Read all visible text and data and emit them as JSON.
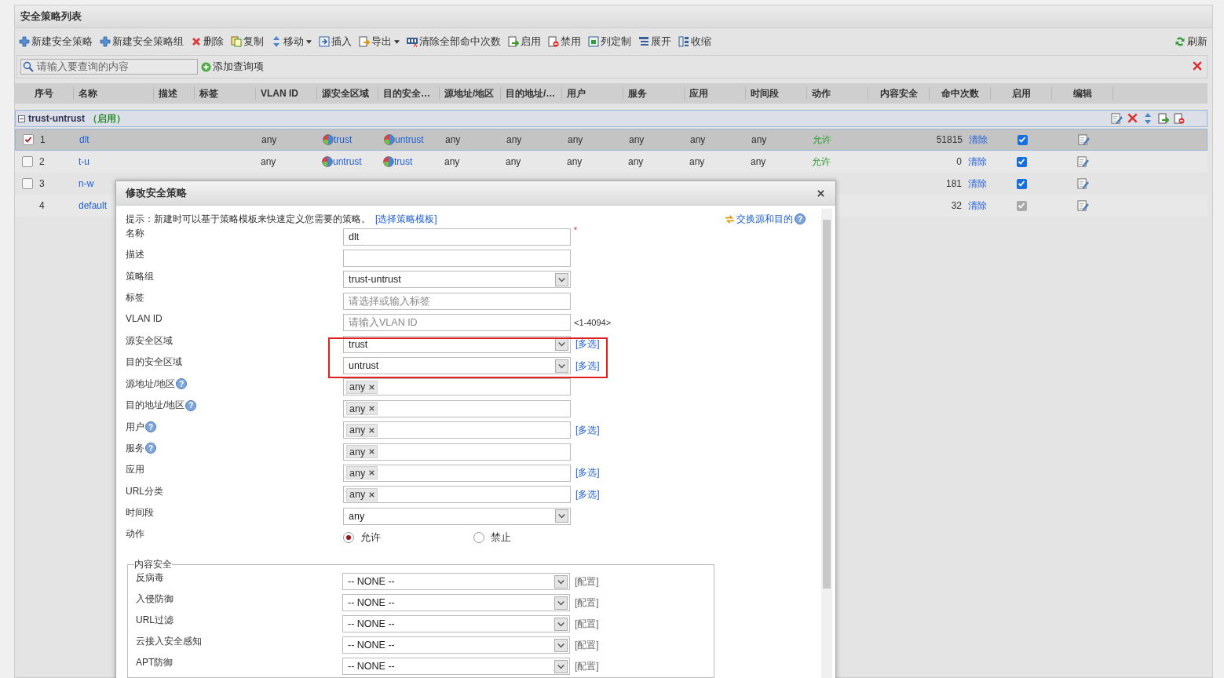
{
  "panel": {
    "title": "安全策略列表"
  },
  "toolbar": [
    {
      "label": "新建安全策略",
      "kind": "plus"
    },
    {
      "label": "新建安全策略组",
      "kind": "plus"
    },
    {
      "label": "删除",
      "kind": "delete"
    },
    {
      "label": "复制",
      "kind": "copy"
    },
    {
      "label": "移动",
      "kind": "move",
      "dropdown": true
    },
    {
      "label": "插入",
      "kind": "insert"
    },
    {
      "label": "导出",
      "kind": "export",
      "dropdown": true
    },
    {
      "label": "清除全部命中次数",
      "kind": "counter"
    },
    {
      "label": "启用",
      "kind": "enable"
    },
    {
      "label": "禁用",
      "kind": "disable"
    },
    {
      "label": "列定制",
      "kind": "columns"
    },
    {
      "label": "展开",
      "kind": "expand"
    },
    {
      "label": "收缩",
      "kind": "collapse"
    }
  ],
  "refresh": "刷新",
  "search": {
    "placeholder": "请输入要查询的内容",
    "add_label": "添加查询项"
  },
  "table": {
    "columns": [
      "序号",
      "名称",
      "描述",
      "标签",
      "VLAN ID",
      "源安全区域",
      "目的安全…",
      "源地址/地区",
      "目的地址/…",
      "用户",
      "服务",
      "应用",
      "时间段",
      "动作",
      "内容安全",
      "命中次数",
      "启用",
      "编辑"
    ],
    "group": {
      "name": "trust-untrust",
      "status": "（启用）",
      "expanded": true
    },
    "rows": [
      {
        "selected": true,
        "checked": true,
        "index": "1",
        "name": "dlt",
        "vlan": "any",
        "src_zone": "trust",
        "dst_zone": "untrust",
        "src_addr": "any",
        "dst_addr": "any",
        "user": "any",
        "service": "any",
        "app": "any",
        "time": "any",
        "action": "允许",
        "hits": "51815",
        "clear": "清除",
        "enabled": true,
        "disabled": false
      },
      {
        "selected": false,
        "checked": false,
        "index": "2",
        "name": "t-u",
        "vlan": "any",
        "src_zone": "untrust",
        "dst_zone": "trust",
        "src_addr": "any",
        "dst_addr": "any",
        "user": "any",
        "service": "any",
        "app": "any",
        "time": "any",
        "action": "允许",
        "hits": "0",
        "clear": "清除",
        "enabled": true,
        "disabled": false
      },
      {
        "selected": false,
        "checked": false,
        "index": "3",
        "name": "n-w",
        "hits": "181",
        "clear": "清除",
        "enabled": true,
        "disabled": false
      },
      {
        "selected": false,
        "index": "4",
        "name": "default",
        "hits": "32",
        "clear": "清除",
        "enabled": true,
        "disabled": true
      }
    ]
  },
  "dialog": {
    "title": "修改安全策略",
    "hint": "提示：新建时可以基于策略模板来快速定义您需要的策略。",
    "template_link": "[选择策略模板]",
    "swap_link": "交换源和目的",
    "swap_help": "?",
    "fields": [
      {
        "label": "名称",
        "kind": "text",
        "value": "dlt",
        "mark": "*"
      },
      {
        "label": "描述",
        "kind": "text"
      },
      {
        "label": "策略组",
        "kind": "select",
        "value": "trust-untrust"
      },
      {
        "label": "标签",
        "kind": "text",
        "placeholder": "请选择或输入标签"
      },
      {
        "label": "VLAN ID",
        "kind": "text",
        "placeholder": "请输入VLAN ID",
        "note": "<1-4094>"
      },
      {
        "label": "源安全区域",
        "kind": "select",
        "value": "trust",
        "link": "[多选]"
      },
      {
        "label": "目的安全区域",
        "kind": "select",
        "value": "untrust",
        "link": "[多选]"
      },
      {
        "label": "源地址/地区",
        "help": "?",
        "kind": "tags",
        "tags": [
          "any"
        ]
      },
      {
        "label": "目的地址/地区",
        "help": "?",
        "kind": "tags",
        "tags": [
          "any"
        ]
      },
      {
        "label": "用户",
        "help": "?",
        "kind": "tags",
        "tags": [
          "any"
        ],
        "link": "[多选]"
      },
      {
        "label": "服务",
        "help": "?",
        "kind": "tags",
        "tags": [
          "any"
        ]
      },
      {
        "label": "应用",
        "kind": "tags",
        "tags": [
          "any"
        ],
        "link": "[多选]"
      },
      {
        "label": "URL分类",
        "kind": "tags",
        "tags": [
          "any"
        ],
        "link": "[多选]"
      },
      {
        "label": "时间段",
        "kind": "select",
        "value": "any"
      },
      {
        "label": "动作",
        "kind": "radio",
        "options": [
          {
            "label": "允许",
            "selected": true
          },
          {
            "label": "禁止",
            "selected": false
          }
        ]
      }
    ],
    "content_security": {
      "legend": "内容安全",
      "items": [
        {
          "label": "反病毒",
          "value": "-- NONE --",
          "link": "[配置]"
        },
        {
          "label": "入侵防御",
          "value": "-- NONE --",
          "link": "[配置]"
        },
        {
          "label": "URL过滤",
          "value": "-- NONE --",
          "link": "[配置]"
        },
        {
          "label": "云接入安全感知",
          "value": "-- NONE --",
          "link": "[配置]"
        },
        {
          "label": "APT防御",
          "value": "-- NONE --",
          "link": "[配置]"
        }
      ]
    }
  }
}
